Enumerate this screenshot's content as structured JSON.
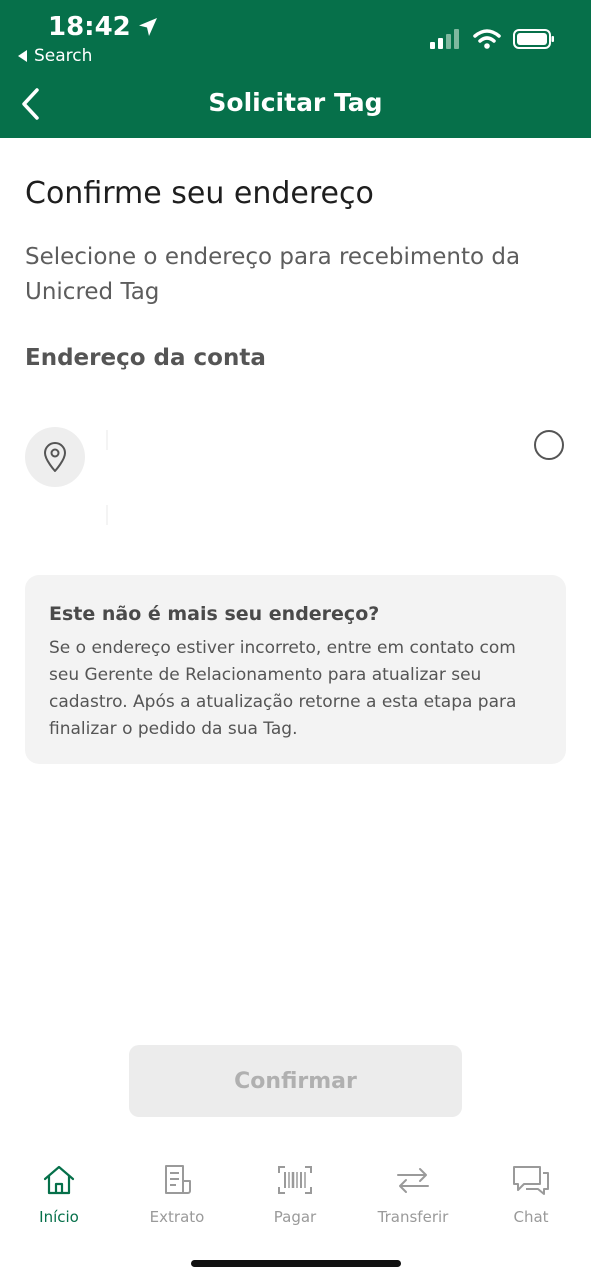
{
  "status_bar": {
    "time": "18:42",
    "back_label": "Search"
  },
  "nav": {
    "title": "Solicitar Tag"
  },
  "main": {
    "title": "Confirme seu endereço",
    "subtitle": "Selecione o endereço para recebimento da Unicred Tag",
    "section_title": "Endereço da conta"
  },
  "info_box": {
    "title": "Este não é mais seu endereço?",
    "text": "Se o endereço estiver incorreto, entre em contato com seu Gerente de Relacionamento para atualizar seu cadastro. Após a atualização retorne a esta etapa para finalizar o pedido da sua Tag."
  },
  "confirm_button": {
    "label": "Confirmar",
    "enabled": false
  },
  "tabbar": {
    "items": [
      {
        "label": "Início",
        "icon": "home-icon",
        "active": true
      },
      {
        "label": "Extrato",
        "icon": "statement-icon",
        "active": false
      },
      {
        "label": "Pagar",
        "icon": "barcode-icon",
        "active": false
      },
      {
        "label": "Transferir",
        "icon": "transfer-icon",
        "active": false
      },
      {
        "label": "Chat",
        "icon": "chat-icon",
        "active": false
      }
    ]
  },
  "colors": {
    "brand": "#06704a",
    "inactive": "#9a9a9a",
    "button_disabled": "#ececec"
  }
}
